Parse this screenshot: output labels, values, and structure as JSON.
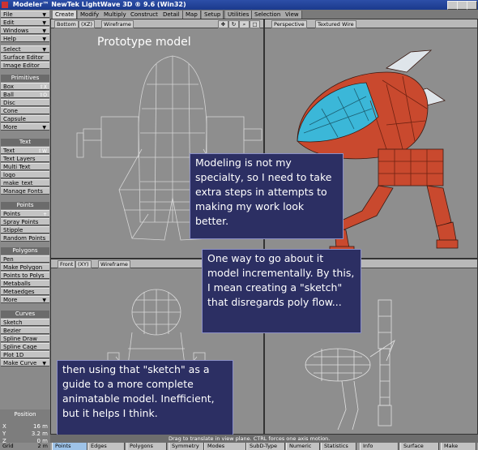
{
  "titlebar": {
    "title": "Modeler™ NewTek LightWave 3D ® 9.6  (Win32)"
  },
  "sidebar": {
    "menus": [
      "File",
      "Edit",
      "Windows",
      "Help",
      "Select",
      "Surface Editor",
      "Image Editor"
    ],
    "primitives_header": "Primitives",
    "primitives": [
      "Box",
      "Ball",
      "Disc",
      "Cone",
      "Capsule",
      "More"
    ],
    "primitives_keys": {
      "box": "⇧X",
      "ball": "⇧O"
    },
    "text_header": "Text",
    "text_items": [
      "Text",
      "Text Layers",
      "Multi Text",
      "logo",
      "make_text",
      "Manage Fonts"
    ],
    "text_key": "⇧W",
    "points_header": "Points",
    "points_items": [
      "Points",
      "Spray Points",
      "Stipple",
      "Random Points"
    ],
    "points_key": "+",
    "polygons_header": "Polygons",
    "polygons_items": [
      "Pen",
      "Make Polygon",
      "Points to Polys",
      "Metaballs",
      "Metaedges",
      "More"
    ],
    "curves_header": "Curves",
    "curves_items": [
      "Sketch",
      "Bezier",
      "Spline Draw",
      "Spline Cage",
      "Plot 1D",
      "Make Curve"
    ],
    "position": {
      "label": "Position",
      "x": "16 m",
      "y": "3.2 m",
      "z": "0 m"
    }
  },
  "tabs": [
    "Create",
    "Modify",
    "Multiply",
    "Construct",
    "Detail",
    "Map",
    "Setup",
    "Utilities",
    "Selection",
    "View"
  ],
  "viewports": {
    "top_left": {
      "view": "Bottom",
      "axes": "(XZ)",
      "mode": "Wireframe"
    },
    "top_right": {
      "view": "Perspective",
      "mode": "Textured Wire"
    },
    "bottom_left": {
      "view": "Front",
      "axes": "(XY)",
      "mode": "Wireframe"
    }
  },
  "overlays": {
    "heading": "Prototype model",
    "note1": "Modeling is not my specialty, so I need to take extra steps in attempts to making my work look better.",
    "note2": "One way to go about it model incrementally. By this, I mean creating a \"sketch\" that disregards poly flow...",
    "note3": "then using that \"sketch\" as a guide to a more complete animatable model. Inefficient, but it helps I think."
  },
  "statusbar": {
    "text": "Drag to translate in view plane. CTRL forces one axis motion."
  },
  "bottombar": {
    "grid_label": "Grid",
    "grid_value": "2 m",
    "buttons": [
      "Points",
      "Edges",
      "Polygons",
      "Symmetry",
      "Modes",
      "SubD-Type",
      "Numeric",
      "Statistics",
      "Info",
      "Surface",
      "Make"
    ]
  },
  "colors": {
    "note_bg": "#2c2f63",
    "model_red": "#c9492e",
    "model_cyan": "#3bb7d8",
    "viewport_bg": "#8e8e8e"
  }
}
